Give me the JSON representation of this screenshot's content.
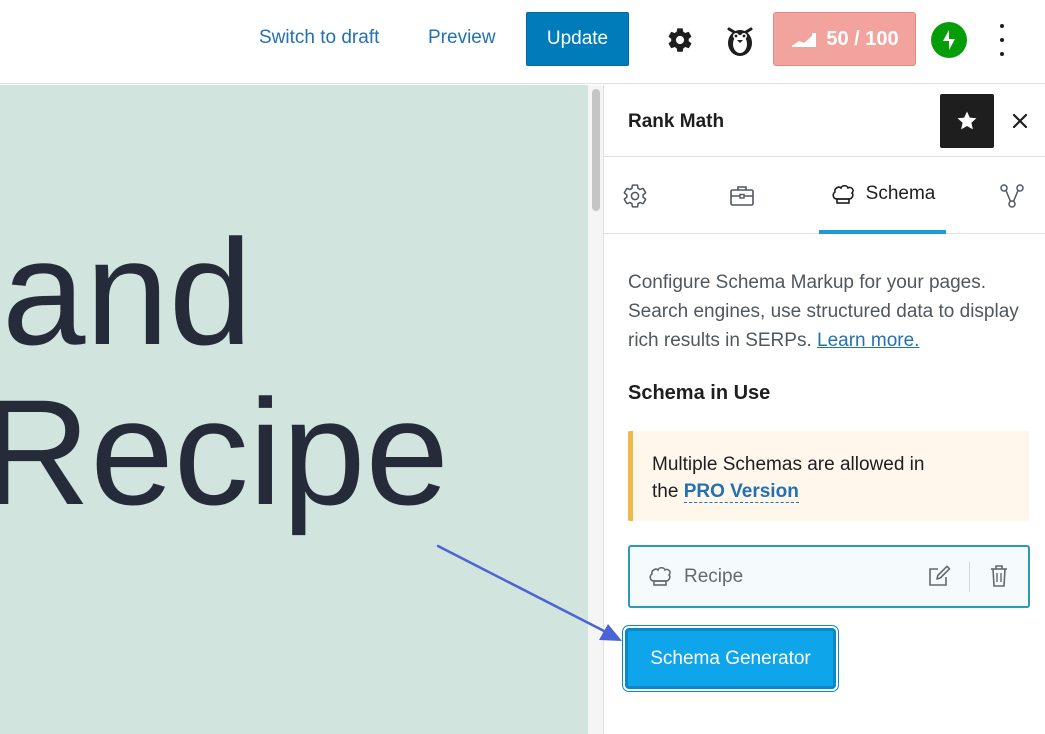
{
  "toolbar": {
    "switch_to_draft": "Switch to draft",
    "preview": "Preview",
    "update": "Update",
    "score": "50 / 100",
    "settings_icon": "gear-icon",
    "plugin_icon": "penguin-icon",
    "jetpack_icon": "bolt-icon",
    "more_icon": "more-vertical-icon"
  },
  "canvas": {
    "line1": "and",
    "line2": "Recipe"
  },
  "sidebar": {
    "title": "Rank Math",
    "tabs": [
      {
        "icon": "gear-icon",
        "label": ""
      },
      {
        "icon": "briefcase-icon",
        "label": ""
      },
      {
        "icon": "chef-hat-icon",
        "label": "Schema"
      },
      {
        "icon": "social-share-icon",
        "label": ""
      }
    ],
    "description": "Configure Schema Markup for your pages. Search engines, use structured data to display rich results in SERPs.",
    "learn_more": "Learn more.",
    "section_title": "Schema in Use",
    "notice_text": "Multiple Schemas are allowed in the",
    "notice_link": "PRO Version",
    "schema_item": "Recipe",
    "generator_button": "Schema Generator"
  },
  "colors": {
    "accent": "#007cba",
    "score_bg": "#f2a39d",
    "canvas_bg": "#d2e4de",
    "tab_active": "#1d9bd7",
    "notice_border": "#f0b849",
    "generator_bg": "#0ea5eb",
    "annotation_arrow": "#4a64d8"
  }
}
